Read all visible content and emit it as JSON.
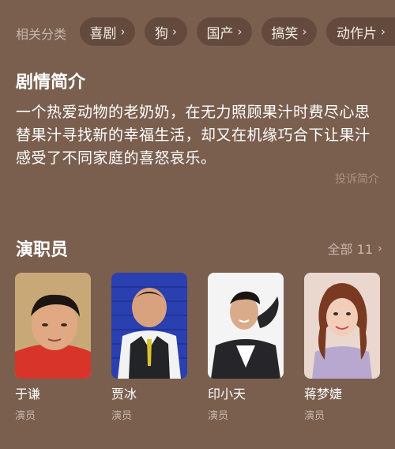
{
  "tags": {
    "label": "相关分类",
    "items": [
      {
        "label": "喜剧"
      },
      {
        "label": "狗"
      },
      {
        "label": "国产"
      },
      {
        "label": "搞笑"
      },
      {
        "label": "动作片"
      }
    ]
  },
  "synopsis": {
    "title": "剧情简介",
    "text": "一个热爱动物的老奶奶，在无力照顾果汁时费尽心思替果汁寻找新的幸福生活，却又在机缘巧合下让果汁感受了不同家庭的喜怒哀乐。",
    "report": "投诉简介"
  },
  "cast": {
    "title": "演职员",
    "all_label": "全部 11",
    "members": [
      {
        "name": "于谦",
        "role": "演员"
      },
      {
        "name": "贾冰",
        "role": "演员"
      },
      {
        "name": "印小天",
        "role": "演员"
      },
      {
        "name": "蒋梦婕",
        "role": "演员"
      }
    ]
  },
  "icons": {
    "chevron": "chevron-right-icon"
  },
  "colors": {
    "background": "#7a5f4f",
    "tag_background": "#634a3c",
    "muted_text": "#c8b6aa"
  }
}
